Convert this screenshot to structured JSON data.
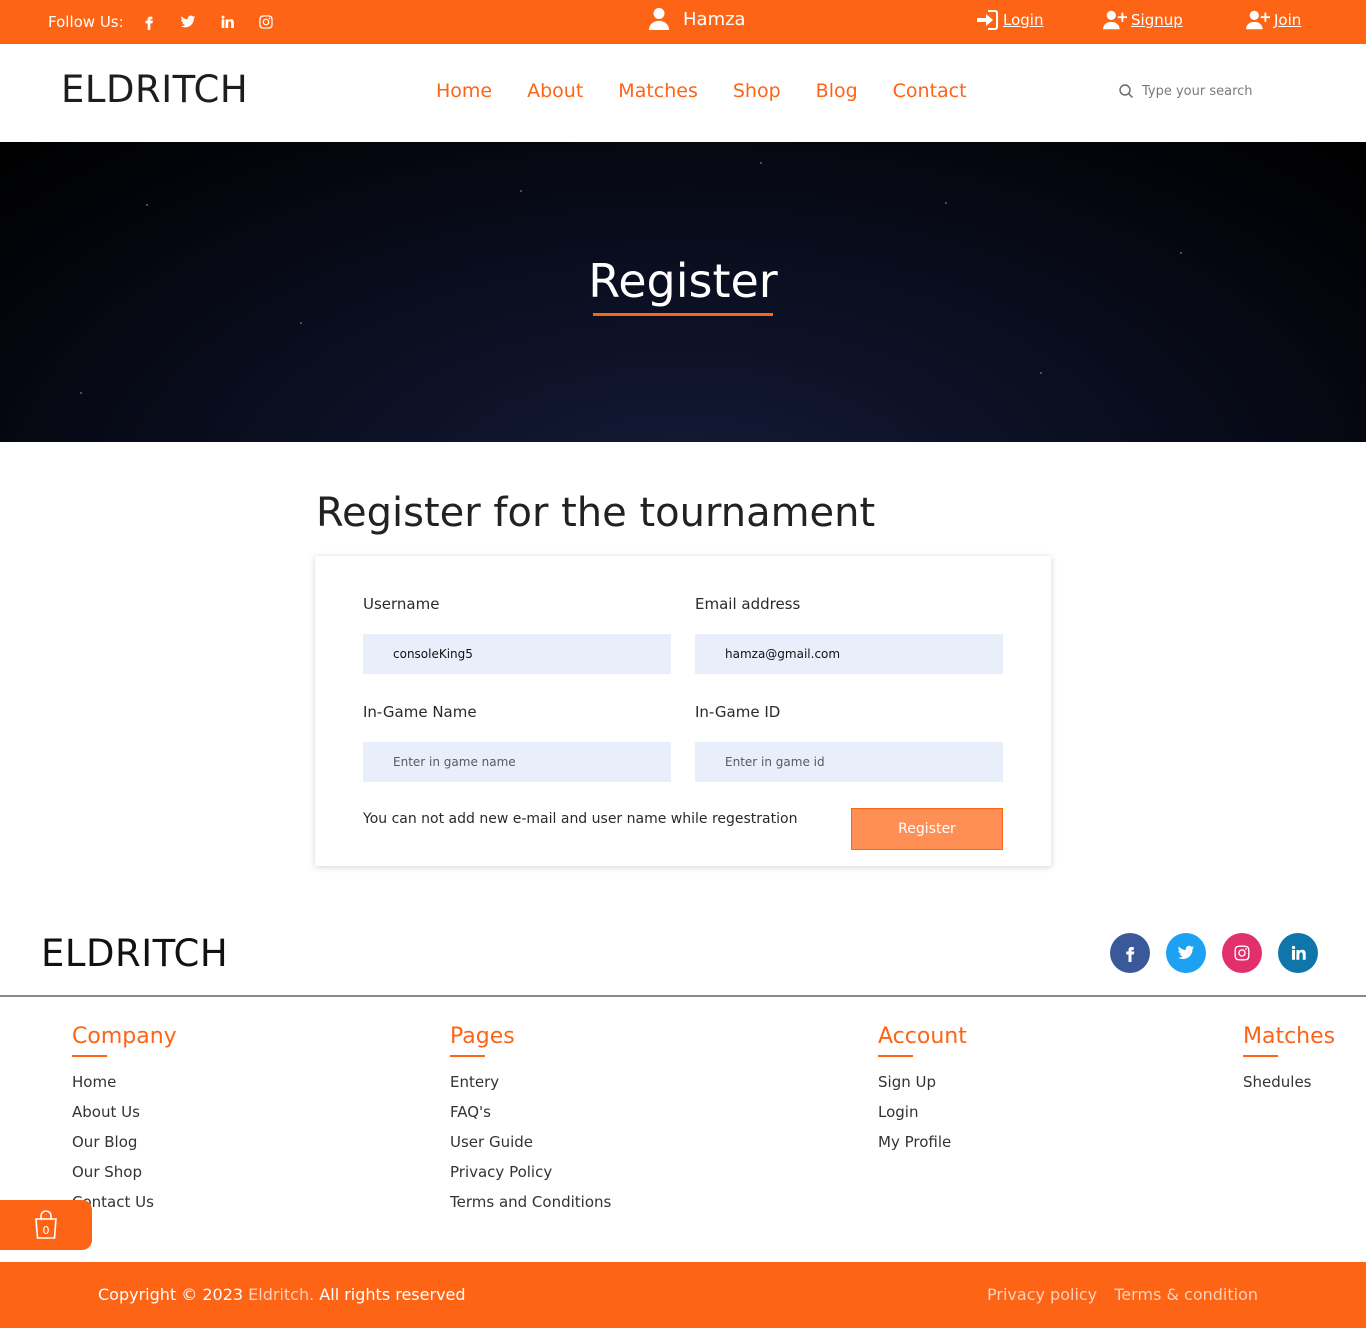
{
  "topbar": {
    "follow_label": "Follow Us:",
    "social_icons": [
      "facebook-icon",
      "twitter-icon",
      "linkedin-icon",
      "instagram-icon"
    ],
    "user_name": "Hamza",
    "login": "Login",
    "signup": "Signup",
    "join": "Join",
    "background": "#fd6416"
  },
  "header": {
    "logo": "ELDRITCH",
    "nav": [
      "Home",
      "About",
      "Matches",
      "Shop",
      "Blog",
      "Contact"
    ],
    "search_placeholder": "Type your search"
  },
  "hero": {
    "title": "Register"
  },
  "form": {
    "heading": "Register for the tournament",
    "username_label": "Username",
    "username_value": "consoleKing5",
    "email_label": "Email address",
    "email_value": "hamza@gmail.com",
    "ign_label": "In-Game Name",
    "ign_placeholder": "Enter in game name",
    "igid_label": "In-Game ID",
    "igid_placeholder": "Enter in game id",
    "note": "You can not add new e-mail and user name while regestration",
    "submit": "Register"
  },
  "footer": {
    "logo": "ELDRITCH",
    "social": [
      {
        "icon": "facebook-icon",
        "color": "#3b5998"
      },
      {
        "icon": "twitter-icon",
        "color": "#1da1f2"
      },
      {
        "icon": "instagram-icon",
        "color": "#e1306c"
      },
      {
        "icon": "linkedin-icon",
        "color": "#0e76a8"
      }
    ],
    "columns": [
      {
        "title": "Company",
        "links": [
          "Home",
          "About Us",
          "Our Blog",
          "Our Shop",
          "Contact Us"
        ]
      },
      {
        "title": "Pages",
        "links": [
          "Entery",
          "FAQ's",
          "User Guide",
          "Privacy Policy",
          "Terms and Conditions"
        ]
      },
      {
        "title": "Account",
        "links": [
          "Sign Up",
          "Login",
          "My Profile"
        ]
      },
      {
        "title": "Matches",
        "links": [
          "Shedules"
        ]
      }
    ],
    "cart_count": "0",
    "copyright_prefix": "Copyright © 2023",
    "copyright_brand": "Eldritch.",
    "copyright_suffix": "All rights reserved",
    "privacy": "Privacy policy",
    "terms": "Terms & condition"
  }
}
